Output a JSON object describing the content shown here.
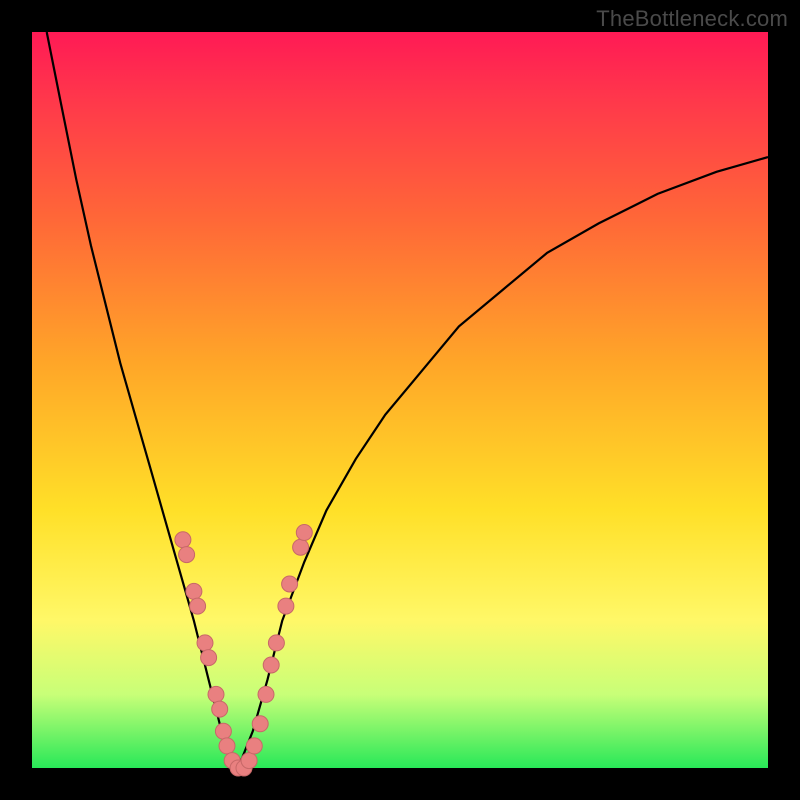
{
  "watermark": {
    "text": "TheBottleneck.com"
  },
  "colors": {
    "background": "#000000",
    "curve_stroke": "#000000",
    "marker_fill": "#e98080",
    "marker_stroke": "#c76868",
    "gradient_top": "#ff1a55",
    "gradient_bottom": "#28e858"
  },
  "chart_data": {
    "type": "line",
    "title": "",
    "xlabel": "",
    "ylabel": "",
    "xlim": [
      0,
      100
    ],
    "ylim": [
      0,
      100
    ],
    "series": [
      {
        "name": "left-curve",
        "x": [
          2,
          4,
          6,
          8,
          10,
          12,
          14,
          16,
          18,
          20,
          22,
          24,
          25.5,
          27,
          28
        ],
        "y": [
          100,
          90,
          80,
          71,
          63,
          55,
          48,
          41,
          34,
          27,
          20,
          12,
          6,
          2,
          0
        ]
      },
      {
        "name": "right-curve",
        "x": [
          28,
          30,
          32,
          34,
          37,
          40,
          44,
          48,
          53,
          58,
          64,
          70,
          77,
          85,
          93,
          100
        ],
        "y": [
          0,
          5,
          12,
          20,
          28,
          35,
          42,
          48,
          54,
          60,
          65,
          70,
          74,
          78,
          81,
          83
        ]
      }
    ],
    "markers": {
      "name": "highlighted-points",
      "points": [
        {
          "x": 20.5,
          "y": 31
        },
        {
          "x": 21.0,
          "y": 29
        },
        {
          "x": 22.0,
          "y": 24
        },
        {
          "x": 22.5,
          "y": 22
        },
        {
          "x": 23.5,
          "y": 17
        },
        {
          "x": 24.0,
          "y": 15
        },
        {
          "x": 25.0,
          "y": 10
        },
        {
          "x": 25.5,
          "y": 8
        },
        {
          "x": 26.0,
          "y": 5
        },
        {
          "x": 26.5,
          "y": 3
        },
        {
          "x": 27.2,
          "y": 1
        },
        {
          "x": 28.0,
          "y": 0
        },
        {
          "x": 28.8,
          "y": 0
        },
        {
          "x": 29.5,
          "y": 1
        },
        {
          "x": 30.2,
          "y": 3
        },
        {
          "x": 31.0,
          "y": 6
        },
        {
          "x": 31.8,
          "y": 10
        },
        {
          "x": 32.5,
          "y": 14
        },
        {
          "x": 33.2,
          "y": 17
        },
        {
          "x": 34.5,
          "y": 22
        },
        {
          "x": 35.0,
          "y": 25
        },
        {
          "x": 36.5,
          "y": 30
        },
        {
          "x": 37.0,
          "y": 32
        }
      ]
    }
  }
}
